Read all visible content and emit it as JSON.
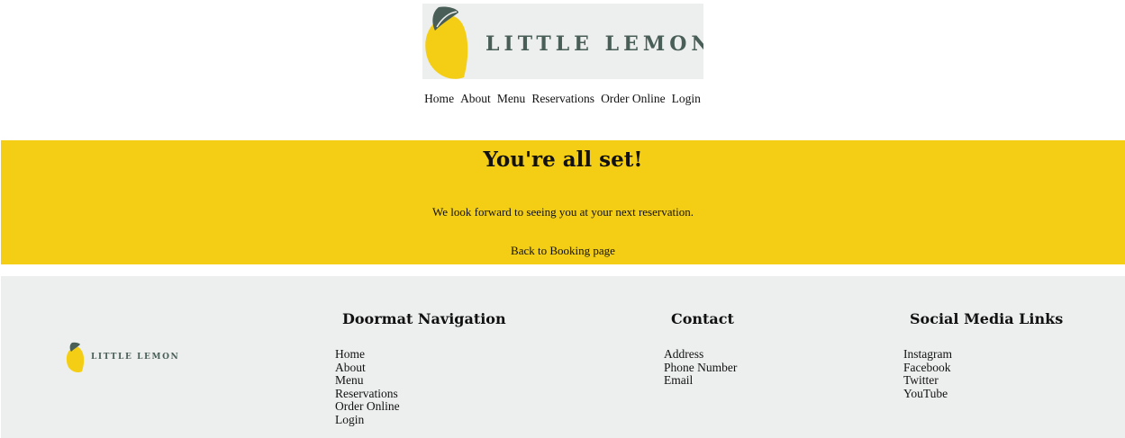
{
  "header": {
    "logo_text": "LITTLE LEMON",
    "nav": [
      "Home",
      "About",
      "Menu",
      "Reservations",
      "Order Online",
      "Login"
    ]
  },
  "hero": {
    "title": "You're all set!",
    "message": "We look forward to seeing you at your next reservation.",
    "back_link": "Back to Booking page"
  },
  "footer": {
    "logo_text": "LITTLE LEMON",
    "doormat": {
      "heading": "Doormat Navigation",
      "items": [
        "Home",
        "About",
        "Menu",
        "Reservations",
        "Order Online",
        "Login"
      ]
    },
    "contact": {
      "heading": "Contact",
      "items": [
        "Address",
        "Phone Number",
        "Email"
      ]
    },
    "social": {
      "heading": "Social Media Links",
      "items": [
        "Instagram",
        "Facebook",
        "Twitter",
        "YouTube"
      ]
    }
  },
  "colors": {
    "brand_yellow": "#f4ce14",
    "brand_green": "#495e57",
    "footer_bg": "#edefee"
  }
}
